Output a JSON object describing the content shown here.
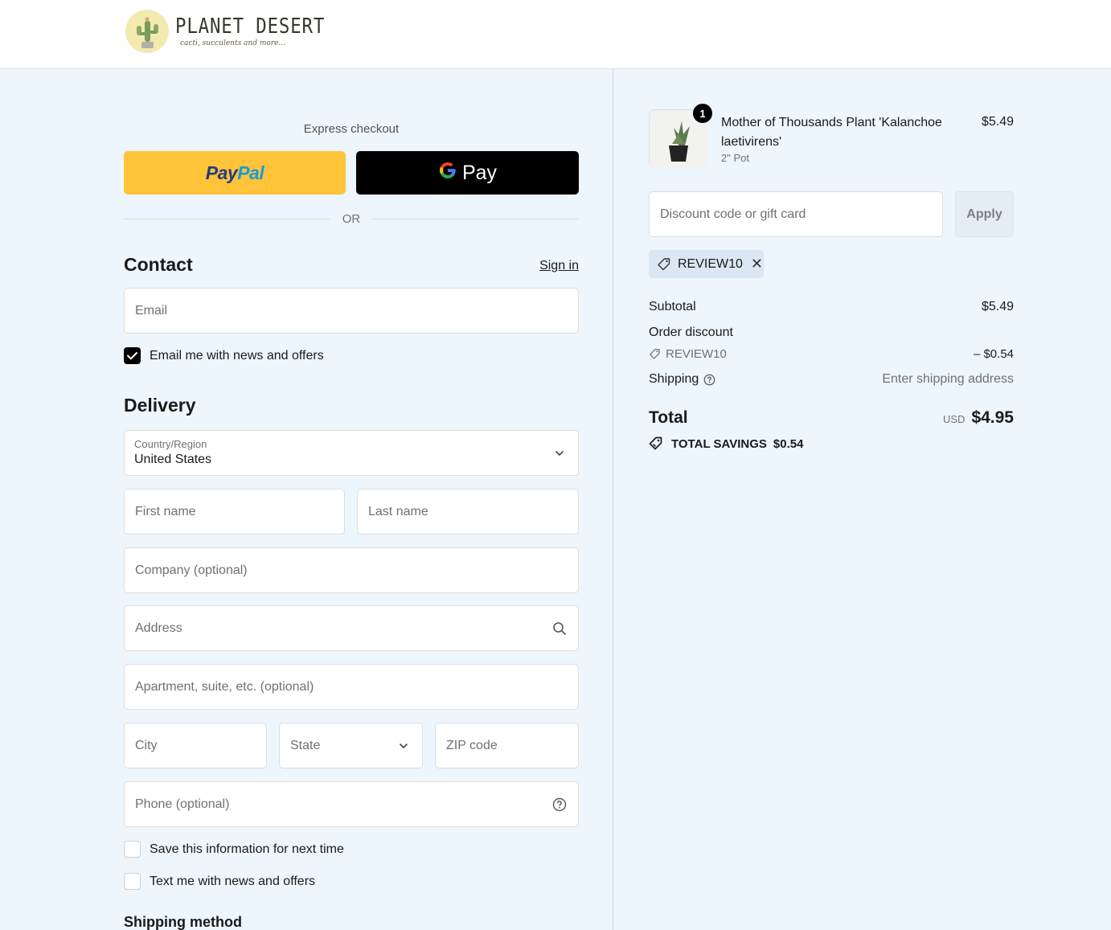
{
  "header": {
    "logo_title": "PLANET DESERT",
    "logo_subtitle": "cacti, succulents and more..."
  },
  "express": {
    "title": "Express checkout",
    "paypal_a": "Pay",
    "paypal_b": "Pal",
    "gpay_g": "G",
    "gpay_text": "Pay",
    "or": "OR"
  },
  "contact": {
    "title": "Contact",
    "sign_in": "Sign in",
    "email_placeholder": "Email",
    "news_label": "Email me with news and offers"
  },
  "delivery": {
    "title": "Delivery",
    "country_label": "Country/Region",
    "country_value": "United States",
    "first_name": "First name",
    "last_name": "Last name",
    "company": "Company (optional)",
    "address": "Address",
    "apartment": "Apartment, suite, etc. (optional)",
    "city": "City",
    "state": "State",
    "zip": "ZIP code",
    "phone": "Phone (optional)",
    "save_info": "Save this information for next time",
    "text_me": "Text me with news and offers"
  },
  "shipping_method": {
    "title": "Shipping method"
  },
  "summary": {
    "item": {
      "quantity": "1",
      "name": "Mother of Thousands Plant 'Kalanchoe laetivirens'",
      "variant": "2\" Pot",
      "price": "$5.49"
    },
    "discount_placeholder": "Discount code or gift card",
    "apply": "Apply",
    "code": "REVIEW10",
    "subtotal_label": "Subtotal",
    "subtotal_value": "$5.49",
    "order_discount_label": "Order discount",
    "discount_code": "REVIEW10",
    "discount_value": "– $0.54",
    "shipping_label": "Shipping",
    "shipping_value": "Enter shipping address",
    "total_label": "Total",
    "currency": "USD",
    "total_value": "$4.95",
    "savings_label": "TOTAL SAVINGS",
    "savings_value": "$0.54"
  },
  "colors": {
    "panel_bg": "#edf5fd",
    "paypal_yellow": "#ffc439",
    "gpay_black": "#000000",
    "checkbox_on": "#000000"
  },
  "icons": [
    "cactus-logo-icon",
    "chevron-down-icon",
    "search-icon",
    "help-circle-icon",
    "tag-icon",
    "close-icon",
    "savings-tag-icon",
    "checkmark-icon"
  ]
}
